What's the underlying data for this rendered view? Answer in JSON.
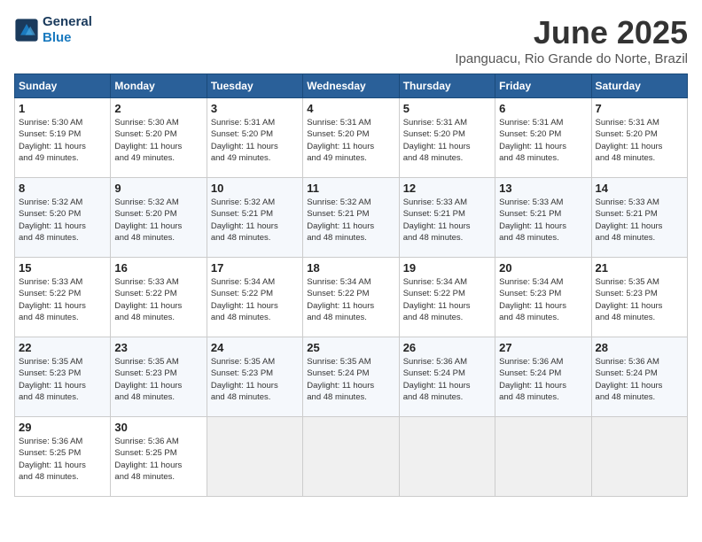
{
  "header": {
    "logo_line1": "General",
    "logo_line2": "Blue",
    "month": "June 2025",
    "location": "Ipanguacu, Rio Grande do Norte, Brazil"
  },
  "weekdays": [
    "Sunday",
    "Monday",
    "Tuesday",
    "Wednesday",
    "Thursday",
    "Friday",
    "Saturday"
  ],
  "weeks": [
    [
      {
        "day": "1",
        "lines": [
          "Sunrise: 5:30 AM",
          "Sunset: 5:19 PM",
          "Daylight: 11 hours",
          "and 49 minutes."
        ]
      },
      {
        "day": "2",
        "lines": [
          "Sunrise: 5:30 AM",
          "Sunset: 5:20 PM",
          "Daylight: 11 hours",
          "and 49 minutes."
        ]
      },
      {
        "day": "3",
        "lines": [
          "Sunrise: 5:31 AM",
          "Sunset: 5:20 PM",
          "Daylight: 11 hours",
          "and 49 minutes."
        ]
      },
      {
        "day": "4",
        "lines": [
          "Sunrise: 5:31 AM",
          "Sunset: 5:20 PM",
          "Daylight: 11 hours",
          "and 49 minutes."
        ]
      },
      {
        "day": "5",
        "lines": [
          "Sunrise: 5:31 AM",
          "Sunset: 5:20 PM",
          "Daylight: 11 hours",
          "and 48 minutes."
        ]
      },
      {
        "day": "6",
        "lines": [
          "Sunrise: 5:31 AM",
          "Sunset: 5:20 PM",
          "Daylight: 11 hours",
          "and 48 minutes."
        ]
      },
      {
        "day": "7",
        "lines": [
          "Sunrise: 5:31 AM",
          "Sunset: 5:20 PM",
          "Daylight: 11 hours",
          "and 48 minutes."
        ]
      }
    ],
    [
      {
        "day": "8",
        "lines": [
          "Sunrise: 5:32 AM",
          "Sunset: 5:20 PM",
          "Daylight: 11 hours",
          "and 48 minutes."
        ]
      },
      {
        "day": "9",
        "lines": [
          "Sunrise: 5:32 AM",
          "Sunset: 5:20 PM",
          "Daylight: 11 hours",
          "and 48 minutes."
        ]
      },
      {
        "day": "10",
        "lines": [
          "Sunrise: 5:32 AM",
          "Sunset: 5:21 PM",
          "Daylight: 11 hours",
          "and 48 minutes."
        ]
      },
      {
        "day": "11",
        "lines": [
          "Sunrise: 5:32 AM",
          "Sunset: 5:21 PM",
          "Daylight: 11 hours",
          "and 48 minutes."
        ]
      },
      {
        "day": "12",
        "lines": [
          "Sunrise: 5:33 AM",
          "Sunset: 5:21 PM",
          "Daylight: 11 hours",
          "and 48 minutes."
        ]
      },
      {
        "day": "13",
        "lines": [
          "Sunrise: 5:33 AM",
          "Sunset: 5:21 PM",
          "Daylight: 11 hours",
          "and 48 minutes."
        ]
      },
      {
        "day": "14",
        "lines": [
          "Sunrise: 5:33 AM",
          "Sunset: 5:21 PM",
          "Daylight: 11 hours",
          "and 48 minutes."
        ]
      }
    ],
    [
      {
        "day": "15",
        "lines": [
          "Sunrise: 5:33 AM",
          "Sunset: 5:22 PM",
          "Daylight: 11 hours",
          "and 48 minutes."
        ]
      },
      {
        "day": "16",
        "lines": [
          "Sunrise: 5:33 AM",
          "Sunset: 5:22 PM",
          "Daylight: 11 hours",
          "and 48 minutes."
        ]
      },
      {
        "day": "17",
        "lines": [
          "Sunrise: 5:34 AM",
          "Sunset: 5:22 PM",
          "Daylight: 11 hours",
          "and 48 minutes."
        ]
      },
      {
        "day": "18",
        "lines": [
          "Sunrise: 5:34 AM",
          "Sunset: 5:22 PM",
          "Daylight: 11 hours",
          "and 48 minutes."
        ]
      },
      {
        "day": "19",
        "lines": [
          "Sunrise: 5:34 AM",
          "Sunset: 5:22 PM",
          "Daylight: 11 hours",
          "and 48 minutes."
        ]
      },
      {
        "day": "20",
        "lines": [
          "Sunrise: 5:34 AM",
          "Sunset: 5:23 PM",
          "Daylight: 11 hours",
          "and 48 minutes."
        ]
      },
      {
        "day": "21",
        "lines": [
          "Sunrise: 5:35 AM",
          "Sunset: 5:23 PM",
          "Daylight: 11 hours",
          "and 48 minutes."
        ]
      }
    ],
    [
      {
        "day": "22",
        "lines": [
          "Sunrise: 5:35 AM",
          "Sunset: 5:23 PM",
          "Daylight: 11 hours",
          "and 48 minutes."
        ]
      },
      {
        "day": "23",
        "lines": [
          "Sunrise: 5:35 AM",
          "Sunset: 5:23 PM",
          "Daylight: 11 hours",
          "and 48 minutes."
        ]
      },
      {
        "day": "24",
        "lines": [
          "Sunrise: 5:35 AM",
          "Sunset: 5:23 PM",
          "Daylight: 11 hours",
          "and 48 minutes."
        ]
      },
      {
        "day": "25",
        "lines": [
          "Sunrise: 5:35 AM",
          "Sunset: 5:24 PM",
          "Daylight: 11 hours",
          "and 48 minutes."
        ]
      },
      {
        "day": "26",
        "lines": [
          "Sunrise: 5:36 AM",
          "Sunset: 5:24 PM",
          "Daylight: 11 hours",
          "and 48 minutes."
        ]
      },
      {
        "day": "27",
        "lines": [
          "Sunrise: 5:36 AM",
          "Sunset: 5:24 PM",
          "Daylight: 11 hours",
          "and 48 minutes."
        ]
      },
      {
        "day": "28",
        "lines": [
          "Sunrise: 5:36 AM",
          "Sunset: 5:24 PM",
          "Daylight: 11 hours",
          "and 48 minutes."
        ]
      }
    ],
    [
      {
        "day": "29",
        "lines": [
          "Sunrise: 5:36 AM",
          "Sunset: 5:25 PM",
          "Daylight: 11 hours",
          "and 48 minutes."
        ]
      },
      {
        "day": "30",
        "lines": [
          "Sunrise: 5:36 AM",
          "Sunset: 5:25 PM",
          "Daylight: 11 hours",
          "and 48 minutes."
        ]
      },
      {
        "day": "",
        "lines": []
      },
      {
        "day": "",
        "lines": []
      },
      {
        "day": "",
        "lines": []
      },
      {
        "day": "",
        "lines": []
      },
      {
        "day": "",
        "lines": []
      }
    ]
  ]
}
